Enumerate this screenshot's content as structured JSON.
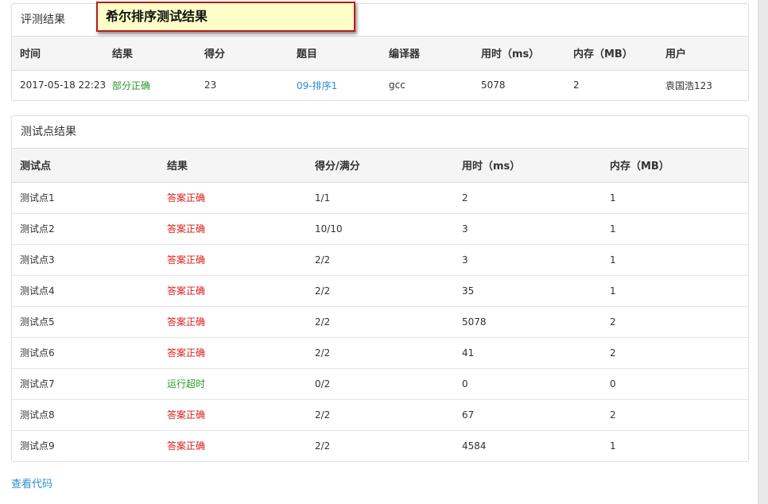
{
  "banner": {
    "title": "希尔排序测试结果"
  },
  "judge": {
    "heading": "评测结果",
    "columns": [
      "时间",
      "结果",
      "得分",
      "题目",
      "编译器",
      "用时（ms）",
      "内存（MB）",
      "用户"
    ],
    "row": {
      "time": "2017-05-18 22:23",
      "result": "部分正确",
      "score": "23",
      "problem": "09-排序1",
      "compiler": "gcc",
      "time_ms": "5078",
      "memory_mb": "2",
      "user": "袁国浩123"
    }
  },
  "tests": {
    "heading": "测试点结果",
    "columns": [
      "测试点",
      "结果",
      "得分/满分",
      "用时（ms）",
      "内存（MB）"
    ],
    "rows": [
      {
        "name": "测试点1",
        "result": "答案正确",
        "status": "ok",
        "score": "1/1",
        "time_ms": "2",
        "memory_mb": "1"
      },
      {
        "name": "测试点2",
        "result": "答案正确",
        "status": "ok",
        "score": "10/10",
        "time_ms": "3",
        "memory_mb": "1"
      },
      {
        "name": "测试点3",
        "result": "答案正确",
        "status": "ok",
        "score": "2/2",
        "time_ms": "3",
        "memory_mb": "1"
      },
      {
        "name": "测试点4",
        "result": "答案正确",
        "status": "ok",
        "score": "2/2",
        "time_ms": "35",
        "memory_mb": "1"
      },
      {
        "name": "测试点5",
        "result": "答案正确",
        "status": "ok",
        "score": "2/2",
        "time_ms": "5078",
        "memory_mb": "2"
      },
      {
        "name": "测试点6",
        "result": "答案正确",
        "status": "ok",
        "score": "2/2",
        "time_ms": "41",
        "memory_mb": "2"
      },
      {
        "name": "测试点7",
        "result": "运行超时",
        "status": "tle",
        "score": "0/2",
        "time_ms": "0",
        "memory_mb": "0"
      },
      {
        "name": "测试点8",
        "result": "答案正确",
        "status": "ok",
        "score": "2/2",
        "time_ms": "67",
        "memory_mb": "2"
      },
      {
        "name": "测试点9",
        "result": "答案正确",
        "status": "ok",
        "score": "2/2",
        "time_ms": "4584",
        "memory_mb": "1"
      }
    ]
  },
  "view_code": "查看代码",
  "colors": {
    "correct": "#d9201c",
    "partial": "#2a9a2a",
    "timeout": "#2a9a2a",
    "link": "#2a8fd0"
  }
}
